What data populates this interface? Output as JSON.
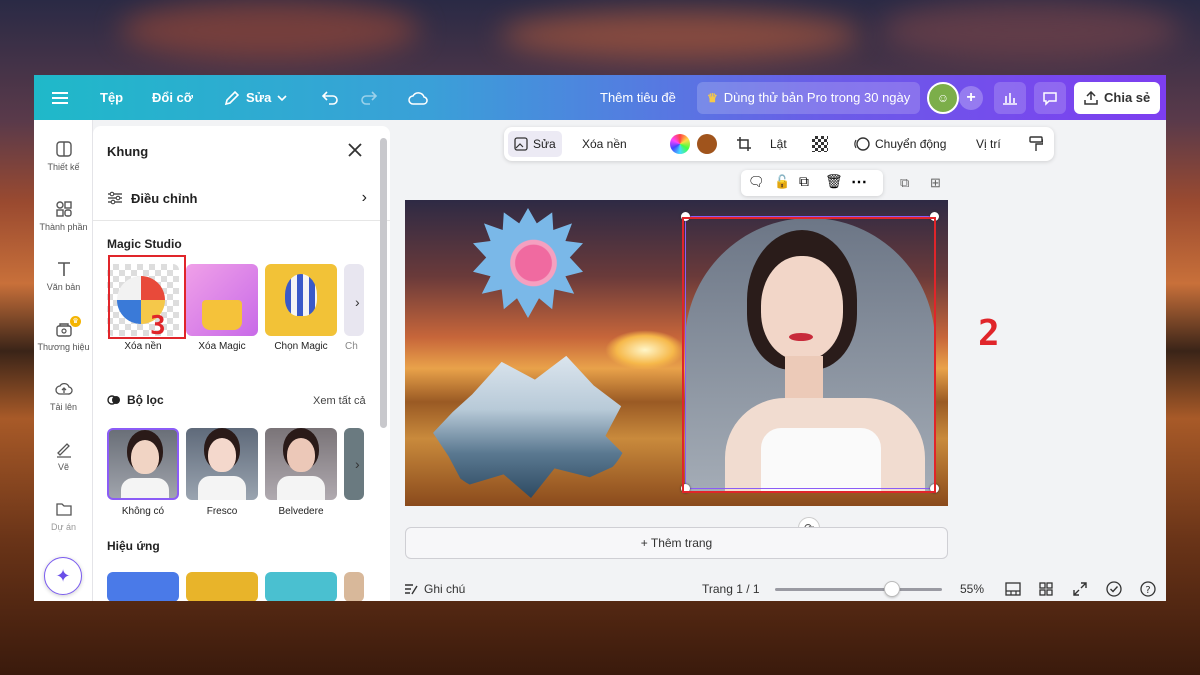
{
  "topbar": {
    "file_label": "Tệp",
    "resize_label": "Đổi cỡ",
    "edit_label": "Sửa",
    "title_placeholder": "Thêm tiêu đề",
    "pro_trial_label": "Dùng thử bản Pro trong 30 ngày",
    "share_label": "Chia sẻ"
  },
  "rail": {
    "items": [
      {
        "label": "Thiết kế",
        "icon": "layout-icon"
      },
      {
        "label": "Thành phần",
        "icon": "shapes-icon"
      },
      {
        "label": "Văn bản",
        "icon": "text-icon"
      },
      {
        "label": "Thương hiệu",
        "icon": "brand-icon"
      },
      {
        "label": "Tải lên",
        "icon": "upload-icon"
      },
      {
        "label": "Vẽ",
        "icon": "draw-icon"
      },
      {
        "label": "Dự án",
        "icon": "folder-icon"
      }
    ]
  },
  "panel": {
    "title": "Khung",
    "adjust_label": "Điều chỉnh",
    "magic_studio_title": "Magic Studio",
    "magic_items": [
      {
        "label": "Xóa nền"
      },
      {
        "label": "Xóa Magic"
      },
      {
        "label": "Chọn Magic"
      },
      {
        "label": "Ch"
      }
    ],
    "filters_title": "Bộ lọc",
    "filters_see_all": "Xem tất cả",
    "filter_items": [
      {
        "label": "Không có"
      },
      {
        "label": "Fresco"
      },
      {
        "label": "Belvedere"
      }
    ],
    "effects_title": "Hiệu ứng"
  },
  "toolbar": {
    "edit_label": "Sửa",
    "remove_bg_label": "Xóa nền",
    "flip_label": "Lật",
    "animate_label": "Chuyển động",
    "position_label": "Vị trí",
    "fill_color": "#a0541c"
  },
  "canvas": {
    "add_page_label": "+ Thêm trang"
  },
  "bottom": {
    "notes_label": "Ghi chú",
    "page_label": "Trang 1 / 1",
    "zoom_label": "55%",
    "zoom_level": 0.55
  },
  "annotations": {
    "number_2": "2",
    "number_3": "3",
    "highlight_color": "#e0252a"
  }
}
